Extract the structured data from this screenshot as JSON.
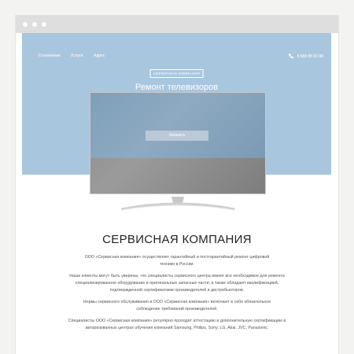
{
  "nav": {
    "items": [
      "О компании",
      "Услуги",
      "Адрес"
    ],
    "phone": "8 888 88 00 88"
  },
  "hero": {
    "badge": "СЕРВИСНАЯ КОМПАНИЯ",
    "title": "Ремонт телевизоров",
    "order_button": "Заказать"
  },
  "about": {
    "title": "СЕРВИСНАЯ КОМПАНИЯ",
    "paragraphs": [
      "ООО «Сервисная компания» осуществляет гарантийный и постгарантийный ремонт цифровой техники в России.",
      "Наши клиенты могут быть уверены, что специалисты сервисного центра имеют все необходимое для ремонта специализированное оборудование и оригинальные запасные части, а также обладают квалификацией, подтвержденной сертификатами производителей и дистрибьюторов.",
      "Нормы сервисного обслуживания в ООО «Сервисная компания» включают в себя обязательное соблюдение требований производителей.",
      "Специалисты ООО «Сервисная компания» регулярно проходят аттестацию и дополнительную сертификацию в авторизованных центрах обучения компаний Samsung, Philips, Sony, LG, Akai, JVC, Panasonic."
    ]
  },
  "colors": {
    "hero_bg": "#a9c6df",
    "page_bg": "#f3f3f1",
    "chrome": "#dedede"
  }
}
